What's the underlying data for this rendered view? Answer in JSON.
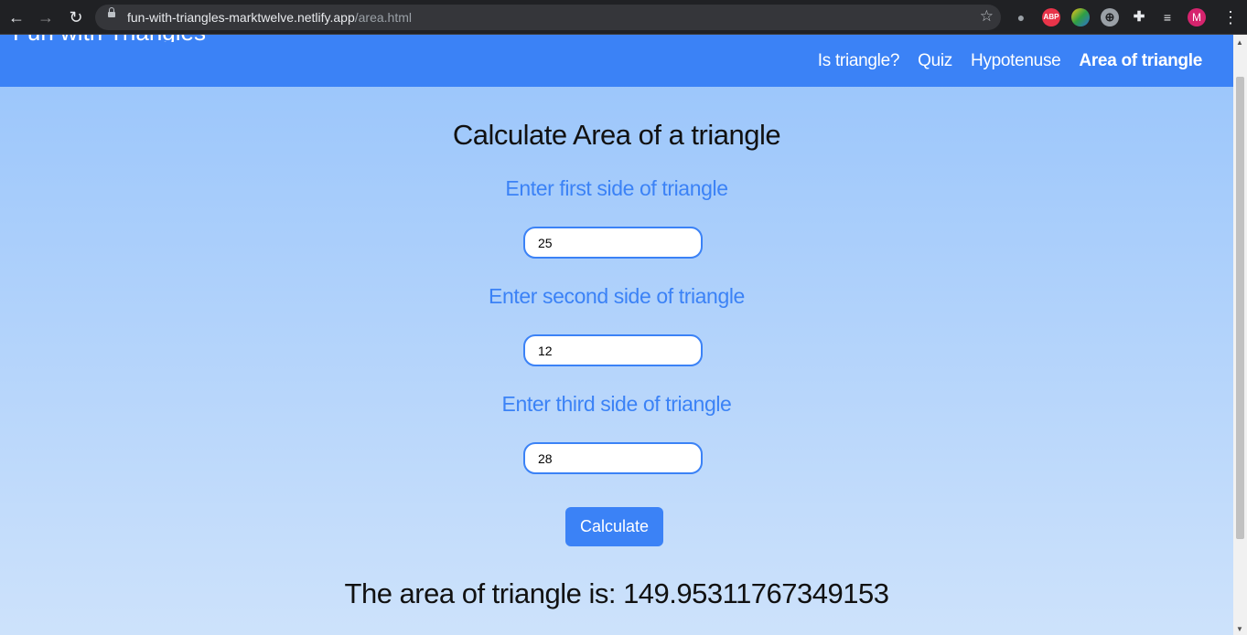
{
  "browser": {
    "url_host": "fun-with-triangles-marktwelve.netlify.app",
    "url_path": "/area.html",
    "profile_initial": "M",
    "abp_label": "ABP"
  },
  "site": {
    "brand": "Fun with Triangles",
    "nav": [
      {
        "label": "Is triangle?"
      },
      {
        "label": "Quiz"
      },
      {
        "label": "Hypotenuse"
      },
      {
        "label": "Area of triangle",
        "active": true
      }
    ]
  },
  "main": {
    "title": "Calculate Area of a triangle",
    "inputs": [
      {
        "label": "Enter first side of triangle",
        "value": "25"
      },
      {
        "label": "Enter second side of triangle",
        "value": "12"
      },
      {
        "label": "Enter third side of triangle",
        "value": "28"
      }
    ],
    "button_label": "Calculate",
    "result": "The area of triangle is: 149.95311767349153"
  },
  "colors": {
    "accent": "#3b82f6",
    "header": "#3b82f6",
    "chrome": "#202124"
  }
}
